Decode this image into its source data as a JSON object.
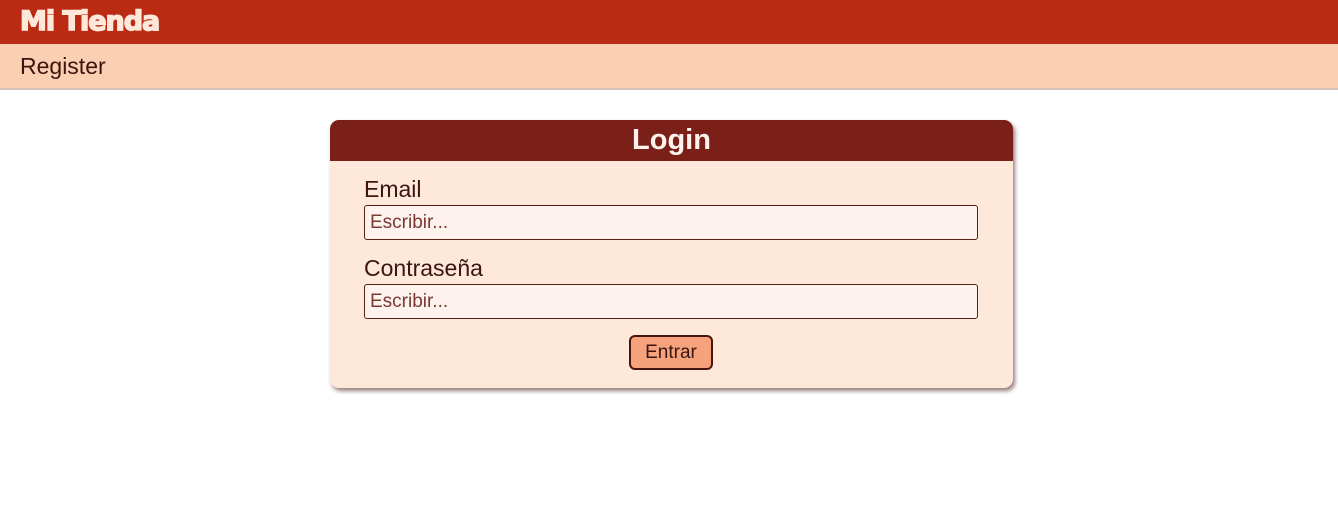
{
  "header": {
    "brand": "Mi Tienda"
  },
  "nav": {
    "register_link": "Register"
  },
  "login": {
    "title": "Login",
    "email_label": "Email",
    "email_placeholder": "Escribir...",
    "password_label": "Contraseña",
    "password_placeholder": "Escribir...",
    "submit_label": "Entrar"
  },
  "colors": {
    "topbar": "#bb2b14",
    "subnav": "#fbcfb2",
    "card_header": "#7a2018",
    "card_body": "#fde8da",
    "button": "#f6a37d"
  }
}
